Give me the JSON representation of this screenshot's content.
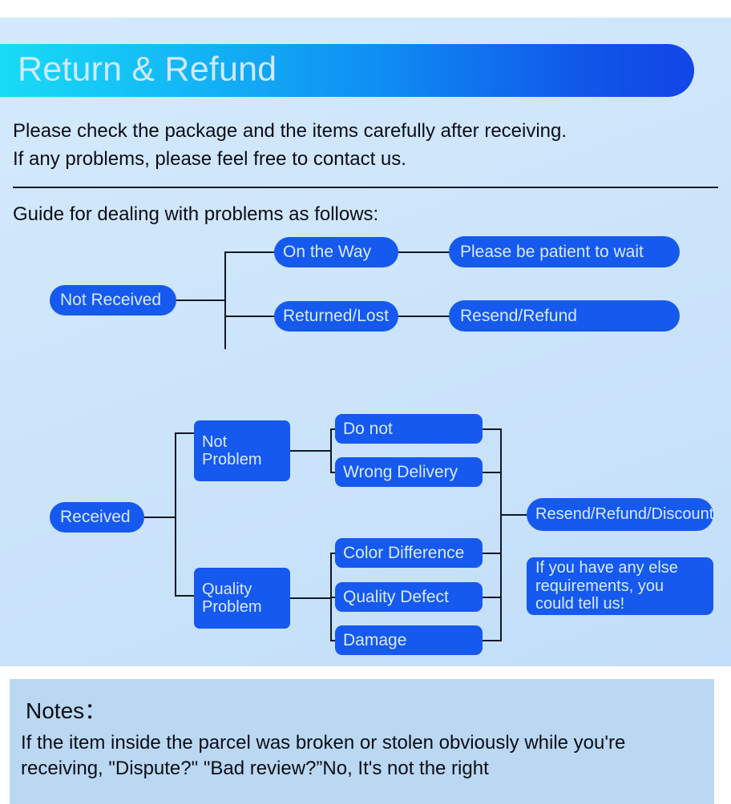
{
  "header": {
    "title": "Return & Refund",
    "gradient_from": "#18dcf5",
    "gradient_to": "#1246e6"
  },
  "intro": {
    "line1": "Please check the package and the items carefully after receiving.",
    "line2": "If any problems, please feel free to contact us.",
    "guide_label": "Guide for dealing with problems as follows:"
  },
  "theme": {
    "node_bg": "#1659ef",
    "node_text": "#d8eafc",
    "panel_bg": "#cfe6fb",
    "notes_bg": "#bad8f2",
    "connector": "#111827",
    "body_text": "#0b0d16"
  },
  "flow_not_received": {
    "root": "Not Received",
    "branches": [
      {
        "cause": "On the Way",
        "action": "Please be patient to wait"
      },
      {
        "cause": "Returned/Lost",
        "action": "Resend/Refund"
      }
    ]
  },
  "flow_received": {
    "root": "Received",
    "categories": [
      {
        "name": "Not\nProblem",
        "line1": "Not",
        "line2": "Problem",
        "items": [
          "Do not",
          "Wrong Delivery"
        ]
      },
      {
        "name": "Quality\nProblem",
        "line1": "Quality",
        "line2": "Problem",
        "items": [
          "Color Difference",
          "Quality Defect",
          "Damage"
        ]
      }
    ],
    "outcomes": [
      "Resend/Refund/Discount",
      "If you have any else requirements, you could tell us!"
    ],
    "outcome2_lines": [
      "If you have any else",
      "requirements, you",
      "could tell us!"
    ]
  },
  "notes": {
    "title": "Notes：",
    "body": "If the item inside the parcel was broken or stolen obviously while you're receiving, \"Dispute?\" \"Bad review?”No, It's not the right"
  }
}
